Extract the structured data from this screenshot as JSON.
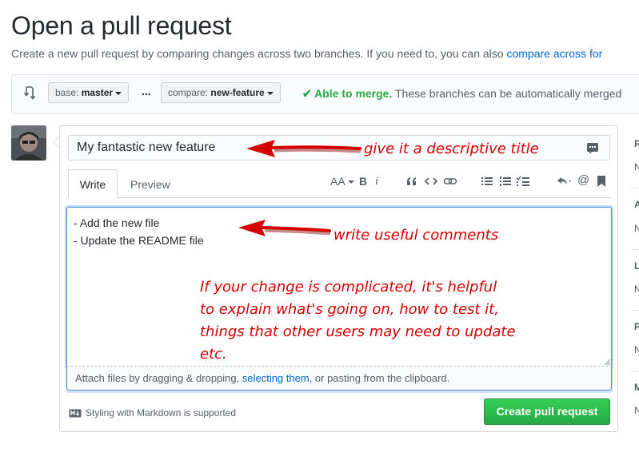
{
  "page": {
    "title": "Open a pull request",
    "subtitle_text": "Create a new pull request by comparing changes across two branches. If you need to, you can also ",
    "subtitle_link": "compare across for"
  },
  "range": {
    "base_prefix": "base:",
    "base_branch": "master",
    "separator": "...",
    "compare_prefix": "compare:",
    "compare_branch": "new-feature",
    "merge_status_bold": "Able to merge.",
    "merge_status_text": " These branches can be automatically merged"
  },
  "form": {
    "title_value": "My fantastic new feature",
    "tabs": [
      {
        "label": "Write",
        "selected": true
      },
      {
        "label": "Preview",
        "selected": false
      }
    ],
    "toolbar": {
      "text_size_label": "AA",
      "bold_label": "B",
      "italic_label": "i"
    },
    "body_value": "- Add the new file\n- Update the README file",
    "attach_text_before": "Attach files by dragging & dropping, ",
    "attach_link": "selecting them",
    "attach_text_after": ", or pasting from the clipboard.",
    "markdown_note": "Styling with Markdown is supported",
    "submit_label": "Create pull request"
  },
  "annotations": {
    "title_hint": "give it a descriptive title",
    "comments_hint": "write useful comments",
    "explain_lines": [
      "If your change is complicated, it's helpful",
      "to explain what's going on, how to test it,",
      "things that other users may need to update",
      "etc."
    ]
  },
  "sidebar_partial": {
    "letters": [
      "R",
      "A",
      "L",
      "P",
      "M"
    ],
    "values": [
      "N",
      "N",
      "N",
      "N",
      "N"
    ]
  },
  "colors": {
    "accent_link": "#0366d6",
    "success_green": "#28a745",
    "annotation_red": "#d50000",
    "focus_border": "#4a90e2"
  },
  "icons": [
    "compare-arrows-icon",
    "checkmark-icon",
    "saved-replies-icon",
    "header-icon",
    "quote-icon",
    "code-icon",
    "link-icon",
    "bulleted-list-icon",
    "numbered-list-icon",
    "task-list-icon",
    "reply-icon",
    "mention-icon",
    "bookmark-icon",
    "markdown-icon"
  ]
}
